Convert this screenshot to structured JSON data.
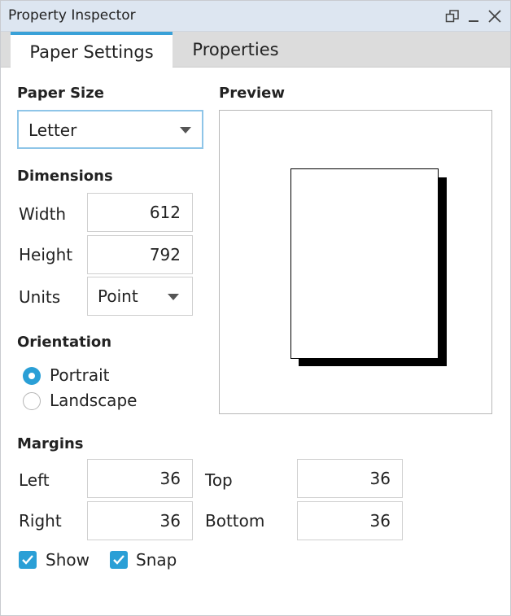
{
  "window": {
    "title": "Property Inspector",
    "icons": [
      "restore-icon",
      "minimize-icon",
      "close-icon"
    ]
  },
  "tabs": [
    {
      "label": "Paper Settings",
      "active": true
    },
    {
      "label": "Properties",
      "active": false
    }
  ],
  "paper_size": {
    "label": "Paper Size",
    "selected": "Letter"
  },
  "dimensions": {
    "label": "Dimensions",
    "width_label": "Width",
    "width_value": "612",
    "height_label": "Height",
    "height_value": "792",
    "units_label": "Units",
    "units_value": "Point"
  },
  "orientation": {
    "label": "Orientation",
    "options": [
      {
        "label": "Portrait",
        "selected": true
      },
      {
        "label": "Landscape",
        "selected": false
      }
    ]
  },
  "preview": {
    "label": "Preview"
  },
  "margins": {
    "label": "Margins",
    "left_label": "Left",
    "left_value": "36",
    "top_label": "Top",
    "top_value": "36",
    "right_label": "Right",
    "right_value": "36",
    "bottom_label": "Bottom",
    "bottom_value": "36"
  },
  "options": {
    "show_label": "Show",
    "show_checked": true,
    "snap_label": "Snap",
    "snap_checked": true
  },
  "colors": {
    "accent": "#2a9fd6",
    "tab_indicator": "#39a1d8",
    "titlebar_bg": "#dde6f1"
  }
}
